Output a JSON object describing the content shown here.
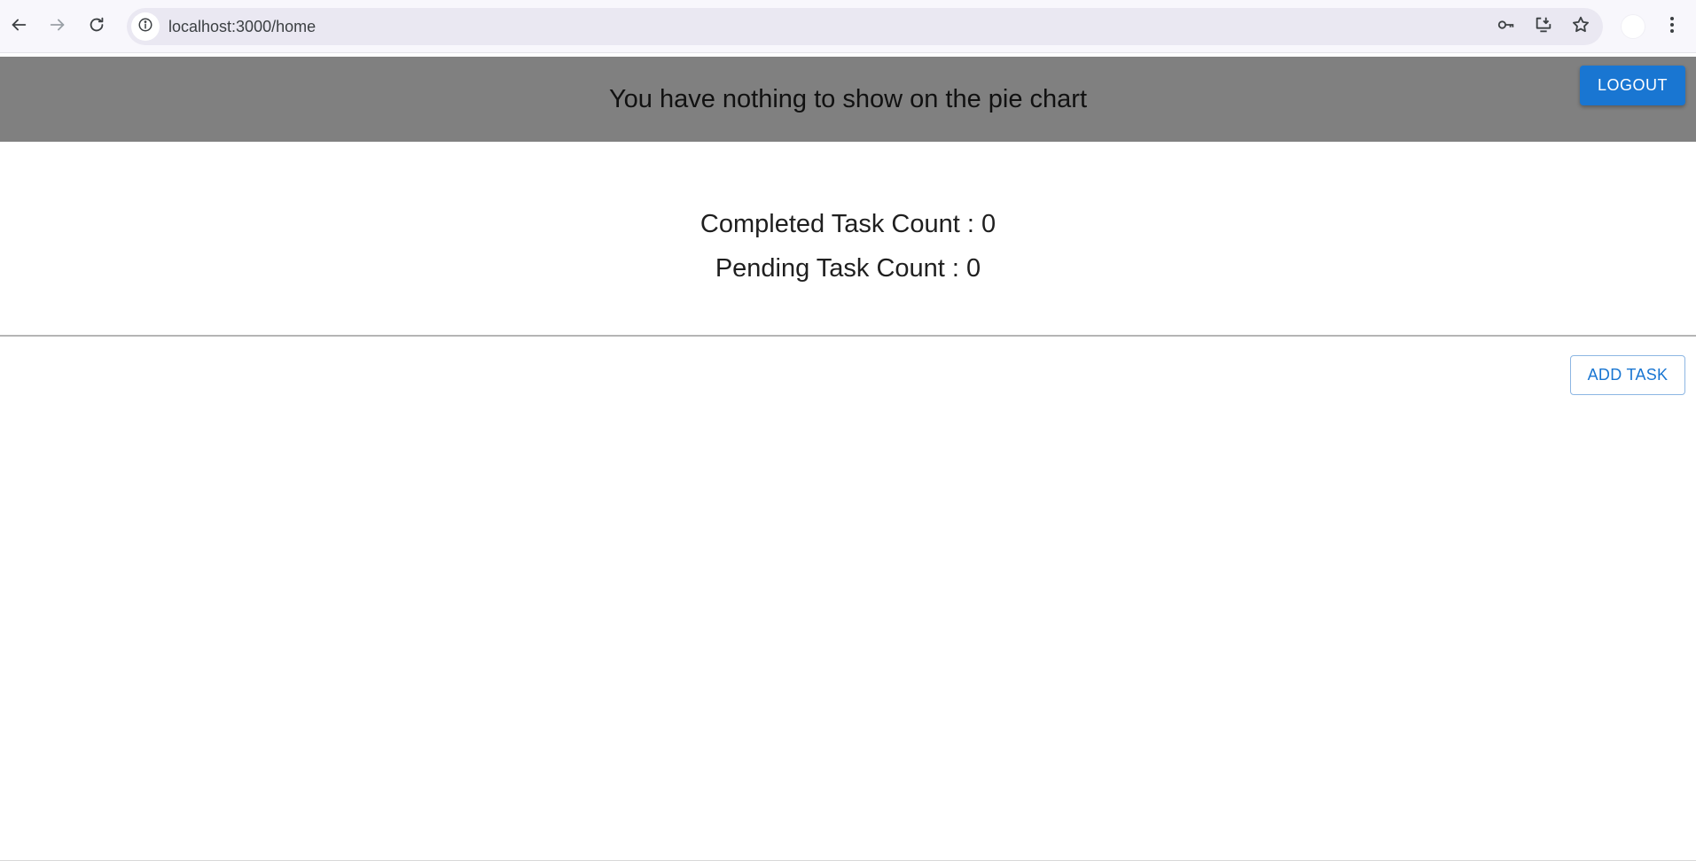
{
  "browser": {
    "url": "localhost:3000/home",
    "icons": {
      "back": "arrow-left-icon",
      "forward": "arrow-right-icon",
      "reload": "reload-icon",
      "site_info": "info-icon",
      "password": "key-icon",
      "install": "install-app-icon",
      "bookmark": "star-icon",
      "menu": "kebab-menu-icon"
    }
  },
  "header": {
    "message": "You have nothing to show on the pie chart",
    "logout_label": "LOGOUT",
    "background_color": "#808080",
    "button_color": "#1976d2"
  },
  "counts": {
    "completed": "Completed Task Count : 0",
    "pending": "Pending Task Count : 0"
  },
  "actions": {
    "add_task_label": "ADD TASK"
  }
}
